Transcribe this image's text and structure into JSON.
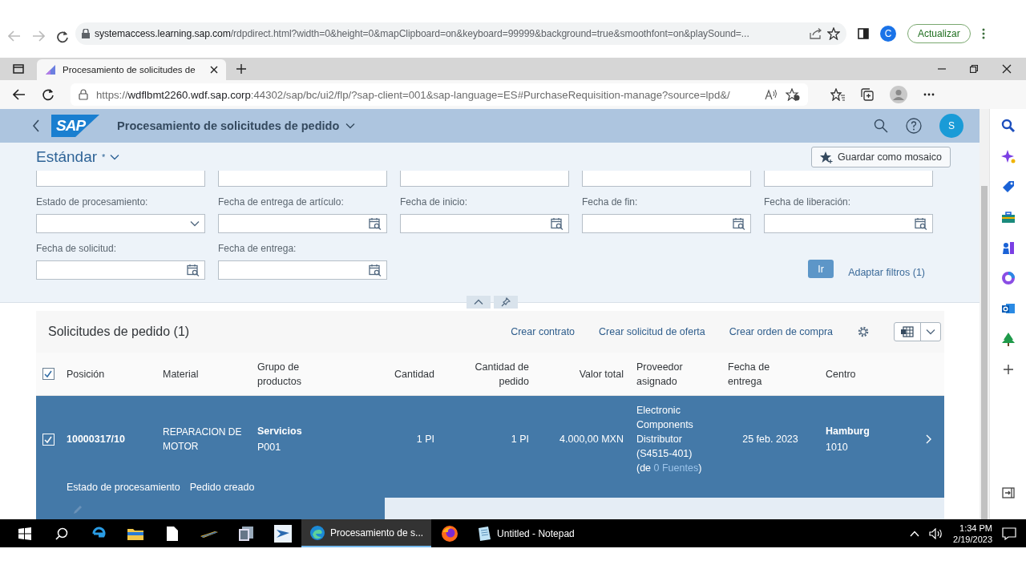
{
  "outer_browser": {
    "url_host": "systemaccess.learning.sap.com",
    "url_rest": "/rdpdirect.html?width=0&height=0&mapClipboard=on&keyboard=99999&background=true&smoothfont=on&playSound=...",
    "avatar": "C",
    "update_button": "Actualizar"
  },
  "inner_browser": {
    "tab_title": "Procesamiento de solicitudes de",
    "url_scheme": "https://",
    "url_host": "wdflbmt2260.wdf.sap.corp",
    "url_rest": ":44302/sap/bc/ui2/flp/?sap-client=001&sap-language=ES#PurchaseRequisition-manage?source=lpd&/"
  },
  "shell": {
    "logo_text": "SAP",
    "title": "Procesamiento de solicitudes de pedido",
    "user_initial": "S"
  },
  "filter_bar": {
    "variant": "Estándar",
    "variant_mark": "*",
    "save_tile_button": "Guardar como mosaico",
    "fields": [
      {
        "label": "Estado de procesamiento:",
        "kind": "dropdown"
      },
      {
        "label": "Fecha de entrega de artículo:",
        "kind": "date"
      },
      {
        "label": "Fecha de inicio:",
        "kind": "date"
      },
      {
        "label": "Fecha de fin:",
        "kind": "date"
      },
      {
        "label": "Fecha de liberación:",
        "kind": "date"
      },
      {
        "label": "Fecha de solicitud:",
        "kind": "date"
      },
      {
        "label": "Fecha de entrega:",
        "kind": "date"
      }
    ],
    "go_button": "Ir",
    "adapt_filters": "Adaptar filtros (1)"
  },
  "table": {
    "title": "Solicitudes de pedido (1)",
    "actions": [
      "Crear contrato",
      "Crear solicitud de oferta",
      "Crear orden de compra"
    ],
    "select_all_checked": true,
    "columns": [
      {
        "label": "Posición",
        "kind": "text"
      },
      {
        "label": "Material",
        "kind": "text"
      },
      {
        "label": "Grupo de productos",
        "kind": "text"
      },
      {
        "label": "Cantidad",
        "kind": "number"
      },
      {
        "label": "Cantidad de pedido",
        "kind": "number"
      },
      {
        "label": "Valor total",
        "kind": "number"
      },
      {
        "label": "Proveedor asignado",
        "kind": "text"
      },
      {
        "label": "Fecha de entrega",
        "kind": "text"
      },
      {
        "label": "Centro",
        "kind": "text"
      }
    ],
    "rows": [
      {
        "selected": true,
        "cells": [
          {
            "kind": "id",
            "text": "10000317/10"
          },
          {
            "kind": "plain",
            "text": "REPARACION DE MOTOR"
          },
          {
            "kind": "titled",
            "title": "Servicios",
            "subtitle": "P001"
          },
          {
            "kind": "number",
            "text": "1 PI"
          },
          {
            "kind": "number",
            "text": "1 PI"
          },
          {
            "kind": "number",
            "text": "4.000,00 MXN"
          },
          {
            "kind": "supplier",
            "text": "Electronic Components Distributor (S4515-401)",
            "sources_open": "(de",
            "sources_link": "0 Fuentes",
            "sources_close": ")"
          },
          {
            "kind": "centered",
            "text": "25 feb. 2023"
          },
          {
            "kind": "titled",
            "title": "Hamburg",
            "subtitle": "1010"
          }
        ],
        "detail_label": "Estado de procesamiento",
        "detail_value": "Pedido creado"
      }
    ]
  },
  "taskbar": {
    "windows": [
      {
        "title": "Procesamiento de s...",
        "selected": true
      },
      {
        "title": "Untitled - Notepad",
        "selected": false
      }
    ],
    "time": "1:34 PM",
    "date": "2/19/2023"
  }
}
